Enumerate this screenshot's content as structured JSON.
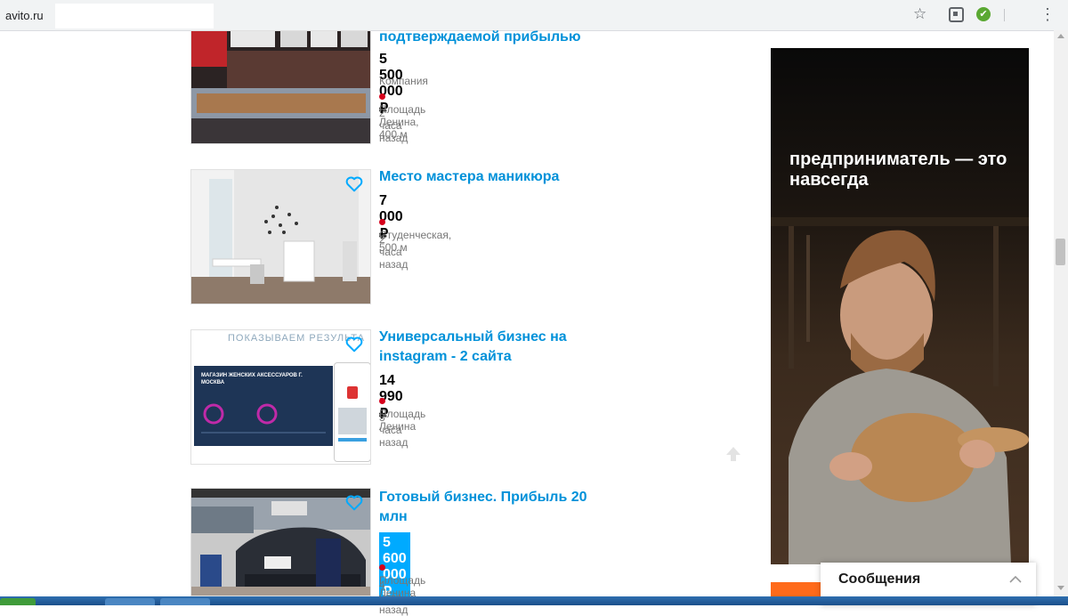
{
  "browser": {
    "url": "avito.ru"
  },
  "listings": [
    {
      "title": "подтверждаемой прибылью",
      "price": "5 500 000 ₽",
      "seller_type": "Компания",
      "location": "Площадь Ленина, 400 м",
      "time": "2 часа назад",
      "favorite": false
    },
    {
      "title": "Место мастера маникюра",
      "price": "7 000 ₽",
      "location": "Студенческая, 500 м",
      "time": "2 часа назад",
      "favorite": true
    },
    {
      "title": "Универсальный бизнес на instagram - 2 сайта",
      "price": "14 990 ₽",
      "location": "Площадь Ленина",
      "time": "3 часа назад",
      "favorite": true,
      "thumb_heading": "ПОКАЗЫВАЕМ РЕЗУЛЬТА",
      "thumb_card_title": "МАГАЗИН ЖЕНСКИХ АКСЕССУАРОВ Г. МОСКВА"
    },
    {
      "title": "Готовый бизнес. Прибыль 20 млн",
      "price": "5 600 000 ₽",
      "price_highlighted": true,
      "location": "Площадь Ленина",
      "time": "4 часа назад",
      "favorite": true
    }
  ],
  "ad": {
    "text": "предприниматель — это навсегда"
  },
  "messages_widget": {
    "label": "Сообщения"
  },
  "colors": {
    "link": "#0091d9",
    "price_highlight": "#00aaff",
    "metro_dot": "#d6001c",
    "ad_accent": "#ff6a1a"
  },
  "icons": {
    "favorite": "heart-outline-icon",
    "scroll_top": "arrow-up-icon",
    "metro": "metro-dot-icon",
    "messages_toggle": "chevron-up-icon"
  }
}
